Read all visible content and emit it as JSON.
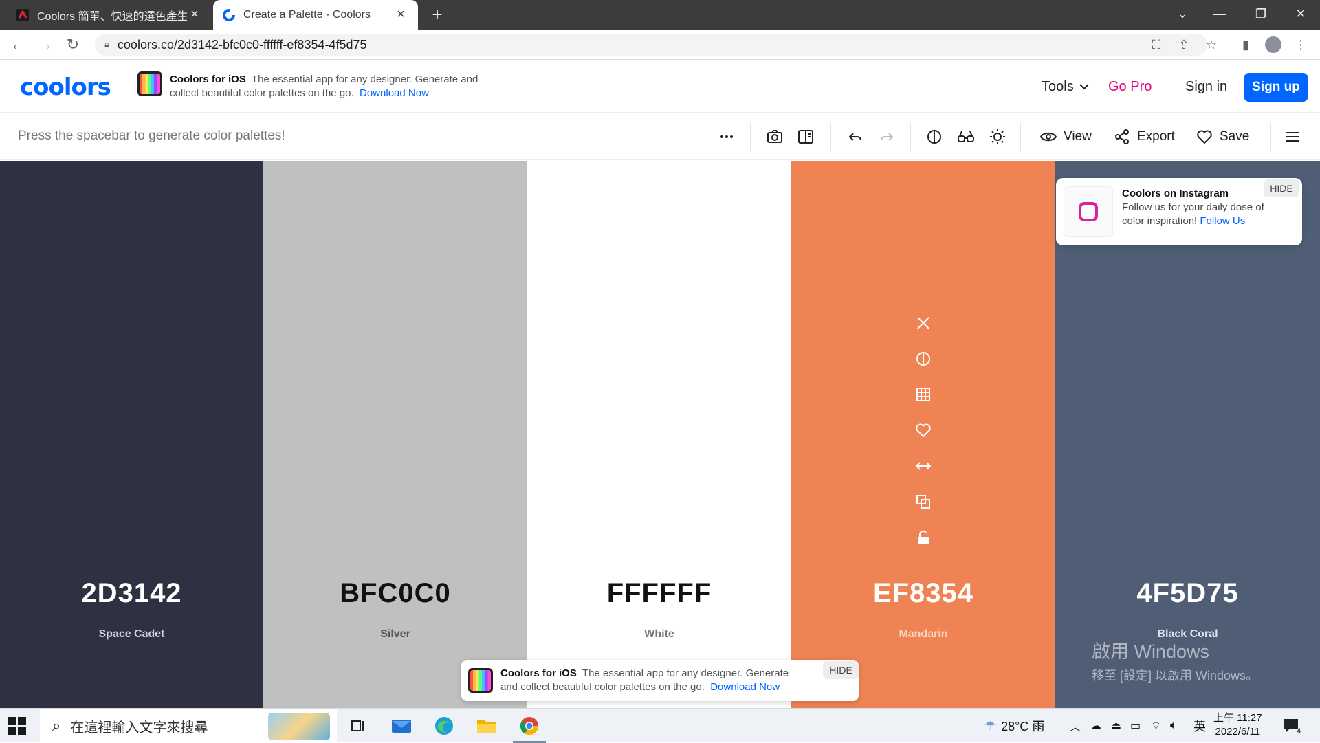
{
  "browser": {
    "tabs": [
      {
        "title": "Coolors 簡單、快速的選色產生器",
        "active": false
      },
      {
        "title": "Create a Palette - Coolors",
        "active": true
      }
    ],
    "url": "coolors.co/2d3142-bfc0c0-ffffff-ef8354-4f5d75"
  },
  "site": {
    "logo": "coolors",
    "promo": {
      "title": "Coolors for iOS",
      "text": "The essential app for any designer. Generate and collect beautiful color palettes on the go.",
      "link": "Download Now"
    },
    "nav": {
      "tools": "Tools",
      "gopro": "Go Pro",
      "signin": "Sign in",
      "signup": "Sign up"
    }
  },
  "toolbar": {
    "hint": "Press the spacebar to generate color palettes!",
    "view": "View",
    "export": "Export",
    "save": "Save"
  },
  "palette": [
    {
      "hex": "2D3142",
      "name": "Space Cadet",
      "bg": "#2d3142",
      "fg": "#ffffff",
      "sub": "#cfd2da"
    },
    {
      "hex": "BFC0C0",
      "name": "Silver",
      "bg": "#bfc0c0",
      "fg": "#111111",
      "sub": "#555555"
    },
    {
      "hex": "FFFFFF",
      "name": "White",
      "bg": "#ffffff",
      "fg": "#111111",
      "sub": "#777777"
    },
    {
      "hex": "EF8354",
      "name": "Mandarin",
      "bg": "#ef8354",
      "fg": "#ffffff",
      "sub": "#fbd6c4"
    },
    {
      "hex": "4F5D75",
      "name": "Black Coral",
      "bg": "#4f5d75",
      "fg": "#ffffff",
      "sub": "#dfe3ea"
    }
  ],
  "instagram": {
    "title": "Coolors on Instagram",
    "text": "Follow us for your daily dose of color inspiration!",
    "link": "Follow Us",
    "hide": "HIDE"
  },
  "bottom_promo": {
    "title": "Coolors for iOS",
    "text": "The essential app for any designer. Generate and collect beautiful color palettes on the go.",
    "link": "Download Now",
    "hide": "HIDE"
  },
  "windows_watermark": {
    "line1": "啟用 Windows",
    "line2": "移至 [設定] 以啟用 Windows。"
  },
  "taskbar": {
    "search_placeholder": "在這裡輸入文字來搜尋",
    "weather": "28°C 雨",
    "ime": "英",
    "time": "上午 11:27",
    "date": "2022/6/11",
    "notifications": "4"
  }
}
